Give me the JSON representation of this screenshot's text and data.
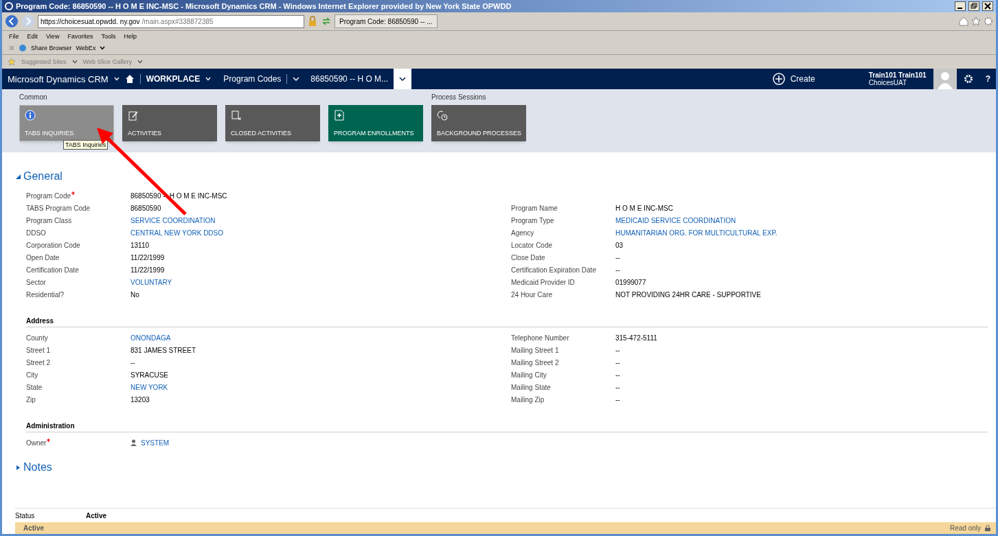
{
  "window": {
    "title": "Program Code: 86850590 -- H O M E INC-MSC - Microsoft Dynamics CRM - Windows Internet Explorer provided by New York State OPWDD"
  },
  "browser": {
    "address_host": "https://choicesuat.opwdd.",
    "address_domain": "ny.gov",
    "address_path": "/main.aspx#338872385",
    "tab": "Program Code: 86850590 -- ...",
    "menu": [
      "File",
      "Edit",
      "View",
      "Favorites",
      "Tools",
      "Help"
    ],
    "command_bar": [
      "Share Browser",
      "WebEx"
    ],
    "favorites": [
      "Suggested Sites",
      "Web Slice Gallery"
    ]
  },
  "nav": {
    "app": "Microsoft Dynamics CRM",
    "area": "WORKPLACE",
    "entity": "Program Codes",
    "record": "86850590 -- H O M...",
    "create": "Create",
    "user": "Train101 Train101",
    "org": "ChoicesUAT",
    "help": "?"
  },
  "ribbon": {
    "groups": [
      {
        "label": "Common",
        "tiles": [
          {
            "label": "TABS INQUIRIES",
            "kind": "info",
            "color": "#8c8c8c",
            "selected": true
          },
          {
            "label": "ACTIVITIES",
            "kind": "activity",
            "color": "#595959",
            "selected": false
          },
          {
            "label": "CLOSED ACTIVITIES",
            "kind": "closed",
            "color": "#595959",
            "selected": false
          },
          {
            "label": "PROGRAM ENROLLMENTS",
            "kind": "enrollment",
            "color": "#006550",
            "selected": false
          }
        ]
      },
      {
        "label": "Process Sessions",
        "tiles": [
          {
            "label": "BACKGROUND PROCESSES",
            "kind": "process",
            "color": "#595959",
            "selected": false
          }
        ]
      }
    ],
    "tooltip": "TABS Inquiries"
  },
  "sections": [
    {
      "title": "General",
      "kind": "tab",
      "expanded": true,
      "rows": [
        {
          "left": {
            "label": "Program Code",
            "value": "86850590 -- H O M E INC-MSC",
            "kind": "text",
            "required": true
          }
        },
        {
          "left": {
            "label": "TABS Program Code",
            "value": "86850590",
            "kind": "text",
            "required": false
          },
          "right": {
            "label": "Program Name",
            "value": "H O M E INC-MSC",
            "kind": "text",
            "required": false
          }
        },
        {
          "left": {
            "label": "Program Class",
            "value": "SERVICE COORDINATION",
            "kind": "link",
            "required": false
          },
          "right": {
            "label": "Program Type",
            "value": "MEDICAID SERVICE COORDINATION",
            "kind": "link",
            "required": false
          }
        },
        {
          "left": {
            "label": "DDSO",
            "value": "CENTRAL NEW YORK DDSO",
            "kind": "link",
            "required": false
          },
          "right": {
            "label": "Agency",
            "value": "HUMANITARIAN ORG. FOR MULTICULTURAL EXP.",
            "kind": "link",
            "required": false
          }
        },
        {
          "left": {
            "label": "Corporation Code",
            "value": "13110",
            "kind": "text",
            "required": false
          },
          "right": {
            "label": "Locator Code",
            "value": "03",
            "kind": "text",
            "required": false
          }
        },
        {
          "left": {
            "label": "Open Date",
            "value": "11/22/1999",
            "kind": "text",
            "required": false
          },
          "right": {
            "label": "Close Date",
            "value": "--",
            "kind": "text",
            "required": false
          }
        },
        {
          "left": {
            "label": "Certification Date",
            "value": "11/22/1999",
            "kind": "text",
            "required": false
          },
          "right": {
            "label": "Certification Expiration Date",
            "value": "--",
            "kind": "text",
            "required": false
          }
        },
        {
          "left": {
            "label": "Sector",
            "value": "VOLUNTARY",
            "kind": "link",
            "required": false
          },
          "right": {
            "label": "Medicaid Provider ID",
            "value": "01999077",
            "kind": "text",
            "required": false
          }
        },
        {
          "left": {
            "label": "Residential?",
            "value": "No",
            "kind": "text",
            "required": false
          },
          "right": {
            "label": "24 Hour Care",
            "value": "NOT PROVIDING 24HR CARE - SUPPORTIVE",
            "kind": "text",
            "required": false
          }
        }
      ]
    },
    {
      "title": "Address",
      "kind": "subsection",
      "rows": [
        {
          "left": {
            "label": "County",
            "value": "ONONDAGA",
            "kind": "link",
            "required": false
          },
          "right": {
            "label": "Telephone Number",
            "value": "315-472-5111",
            "kind": "text",
            "required": false
          }
        },
        {
          "left": {
            "label": "Street 1",
            "value": "831 JAMES STREET",
            "kind": "text",
            "required": false
          },
          "right": {
            "label": "Mailing Street 1",
            "value": "--",
            "kind": "text",
            "required": false
          }
        },
        {
          "left": {
            "label": "Street 2",
            "value": "--",
            "kind": "text",
            "required": false
          },
          "right": {
            "label": "Mailing Street 2",
            "value": "--",
            "kind": "text",
            "required": false
          }
        },
        {
          "left": {
            "label": "City",
            "value": "SYRACUSE",
            "kind": "text",
            "required": false
          },
          "right": {
            "label": "Mailing City",
            "value": "--",
            "kind": "text",
            "required": false
          }
        },
        {
          "left": {
            "label": "State",
            "value": "NEW YORK",
            "kind": "link",
            "required": false
          },
          "right": {
            "label": "Mailing State",
            "value": "--",
            "kind": "text",
            "required": false
          }
        },
        {
          "left": {
            "label": "Zip",
            "value": "13203",
            "kind": "text",
            "required": false
          },
          "right": {
            "label": "Mailing Zip",
            "value": "--",
            "kind": "text",
            "required": false
          }
        }
      ]
    },
    {
      "title": "Administration",
      "kind": "subsection",
      "rows": [
        {
          "left": {
            "label": "Owner",
            "value": "SYSTEM",
            "kind": "user",
            "required": true
          }
        }
      ]
    },
    {
      "title": "Notes",
      "kind": "tab",
      "expanded": false
    }
  ],
  "status": {
    "label": "Status",
    "value": "Active"
  },
  "footer": {
    "state": "Active",
    "note": "Read only"
  }
}
